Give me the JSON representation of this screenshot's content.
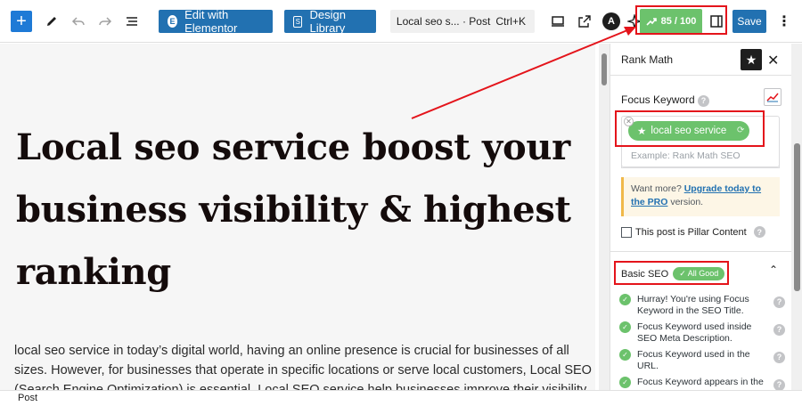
{
  "toolbar": {
    "add_icon": "plus-icon",
    "elementor_label": "Edit with Elementor",
    "design_library_label": "Design Library",
    "document_title": "Local seo s... · Post",
    "shortcut": "Ctrl+K",
    "rank_math_score": "85 / 100",
    "save_label": "Save"
  },
  "post": {
    "title": "Local seo service boost your business visibility & highest ranking",
    "body": "local seo service in today’s digital world, having an online presence is crucial for businesses of all sizes. However, for businesses that operate in specific locations or serve local customers, Local SEO (Search Engine Optimization) is essential. Local SEO service help businesses improve their visibility"
  },
  "sidebar": {
    "title": "Rank Math",
    "focus_keyword_label": "Focus Keyword",
    "keyword_tag": "local seo service",
    "keyword_placeholder": "Example: Rank Math SEO",
    "upsell_prefix": "Want more? ",
    "upsell_link": "Upgrade today to the PRO",
    "upsell_suffix": " version.",
    "pillar_label": "This post is Pillar Content",
    "basic_seo_label": "Basic SEO",
    "basic_seo_badge": "✓ All Good",
    "checks": [
      "Hurray! You're using Focus Keyword in the SEO Title.",
      "Focus Keyword used inside SEO Meta Description.",
      "Focus Keyword used in the URL.",
      "Focus Keyword appears in the"
    ]
  },
  "footer": {
    "breadcrumb": "Post"
  },
  "colors": {
    "accent": "#2271b1",
    "rank_math_green": "#6cc26c",
    "annotation_red": "#e4141b"
  }
}
